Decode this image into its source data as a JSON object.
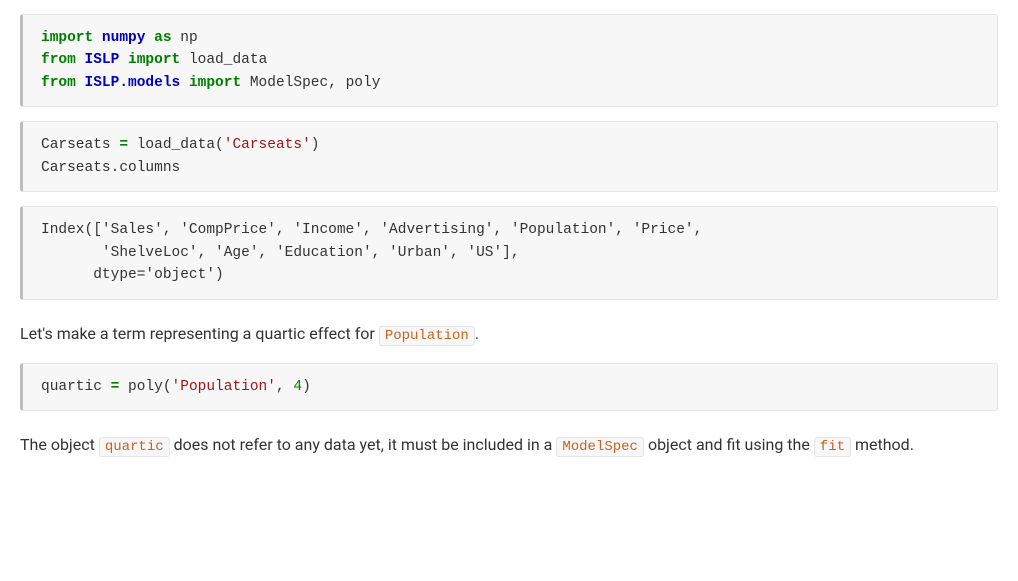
{
  "cells": {
    "code1_line1_import": "import",
    "code1_line1_mod": "numpy",
    "code1_line1_as": "as",
    "code1_line1_alias": "np",
    "code1_line2_from": "from",
    "code1_line2_mod": "ISLP",
    "code1_line2_import": "import",
    "code1_line2_name": "load_data",
    "code1_line3_from": "from",
    "code1_line3_mod": "ISLP.models",
    "code1_line3_import": "import",
    "code1_line3_name1": "ModelSpec",
    "code1_line3_comma": ", ",
    "code1_line3_name2": "poly",
    "code2_line1_a": "Carseats ",
    "code2_line1_eq": "=",
    "code2_line1_b": " load_data(",
    "code2_line1_str": "'Carseats'",
    "code2_line1_c": ")",
    "code2_line2": "Carseats.columns",
    "output1": "Index(['Sales', 'CompPrice', 'Income', 'Advertising', 'Population', 'Price',\n       'ShelveLoc', 'Age', 'Education', 'Urban', 'US'],\n      dtype='object')",
    "prose1_a": "Let's make a term representing a quartic effect for ",
    "prose1_code1": "Population",
    "prose1_b": ".",
    "code3_a": "quartic ",
    "code3_eq": "=",
    "code3_b": " poly(",
    "code3_str": "'Population'",
    "code3_c": ", ",
    "code3_num": "4",
    "code3_d": ")",
    "prose2_a": "The object ",
    "prose2_code1": "quartic",
    "prose2_b": " does not refer to any data yet, it must be included in a ",
    "prose2_code2": "ModelSpec",
    "prose2_c": " object and fit using the ",
    "prose2_code3": "fit",
    "prose2_d": " method."
  }
}
